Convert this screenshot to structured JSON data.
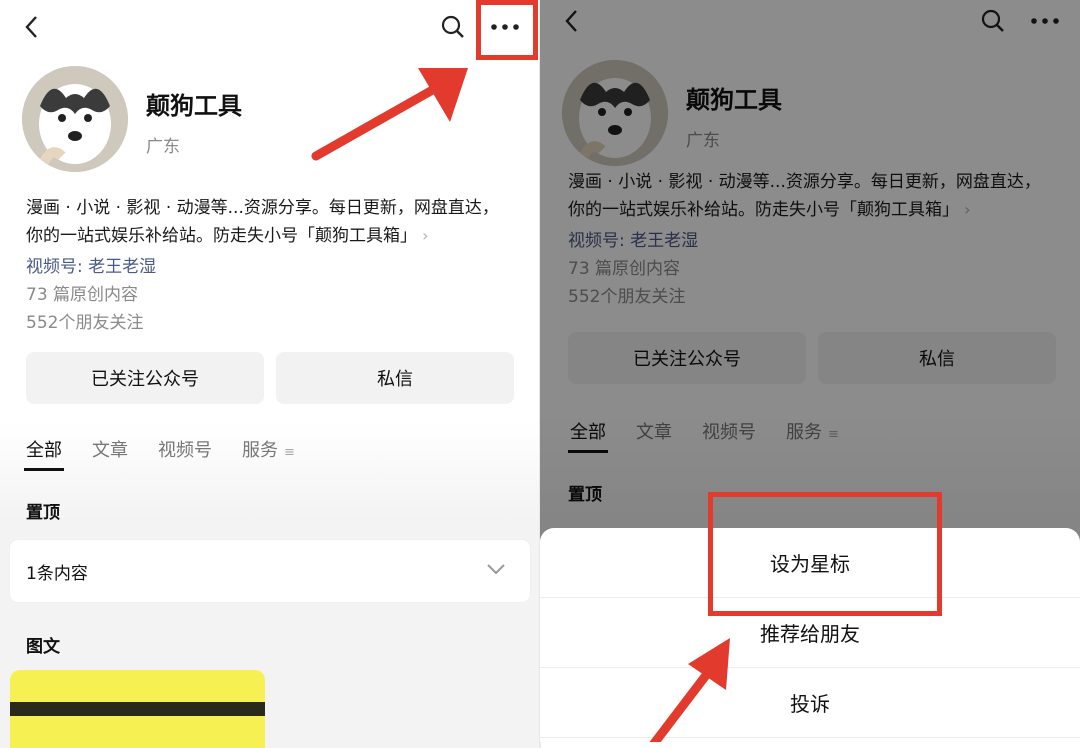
{
  "profile": {
    "name": "颠狗工具",
    "region": "广东",
    "bio_line1": "漫画 · 小说 · 影视 · 动漫等...资源分享。每日更新，网盘直达，",
    "bio_line2": "你的一站式娱乐补给站。防走失小号「颠狗工具箱」",
    "channel": "视频号: 老王老湿",
    "original_count": "73 篇原创内容",
    "friends_follow": "552个朋友关注"
  },
  "actions": {
    "followed_label": "已关注公众号",
    "message_label": "私信"
  },
  "tabs": [
    "全部",
    "文章",
    "视频号",
    "服务"
  ],
  "sections": {
    "pinned_label": "置顶",
    "pinned_count": "1条内容",
    "posts_label": "图文"
  },
  "sheet": {
    "items": [
      "设为星标",
      "推荐给朋友",
      "投诉"
    ]
  },
  "icons": {
    "back": "back-arrow-icon",
    "search": "search-icon",
    "more": "more-dots-icon",
    "chevron": "chevron-down-icon"
  },
  "colors": {
    "highlight": "#e23a2c",
    "link": "#4a5a86"
  }
}
